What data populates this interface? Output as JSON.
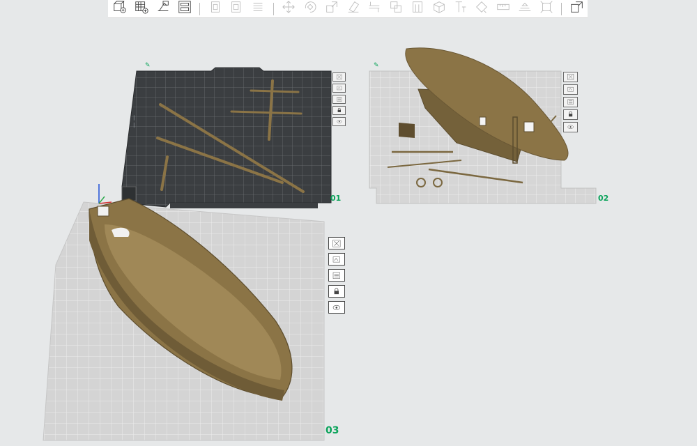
{
  "toolbar": {
    "items": [
      {
        "name": "add-object-icon",
        "enabled": true
      },
      {
        "name": "add-plate-icon",
        "enabled": true
      },
      {
        "name": "auto-orient-icon",
        "enabled": true
      },
      {
        "name": "arrange-icon",
        "enabled": true
      },
      {
        "name": "copy-icon",
        "enabled": false
      },
      {
        "name": "paste-icon",
        "enabled": false
      },
      {
        "name": "layers-icon",
        "enabled": false
      },
      {
        "name": "move-icon",
        "enabled": false
      },
      {
        "name": "rotate-icon",
        "enabled": false
      },
      {
        "name": "scale-icon",
        "enabled": false
      },
      {
        "name": "lay-on-face-icon",
        "enabled": false
      },
      {
        "name": "cut-icon",
        "enabled": false
      },
      {
        "name": "boolean-icon",
        "enabled": false
      },
      {
        "name": "support-paint-icon",
        "enabled": false
      },
      {
        "name": "box-icon",
        "enabled": false
      },
      {
        "name": "text-icon",
        "enabled": false
      },
      {
        "name": "paint-icon",
        "enabled": false
      },
      {
        "name": "measure-icon",
        "enabled": false
      },
      {
        "name": "assembly-icon",
        "enabled": false
      },
      {
        "name": "fit-view-icon",
        "enabled": false
      },
      {
        "name": "split-to-objects-icon",
        "enabled": true
      }
    ]
  },
  "plates": [
    {
      "number": "01",
      "status": "sliced"
    },
    {
      "number": "02",
      "status": "unsliced"
    },
    {
      "number": "03",
      "status": "active"
    }
  ],
  "plate_buttons": [
    "close-icon",
    "auto-arrange-icon",
    "plate-settings-icon",
    "lock-icon",
    "view-icon"
  ],
  "colors": {
    "accent": "#0aa35a",
    "model": "#8b7446",
    "plate_dark": "#3a3d40",
    "plate_light": "#d3d3d3",
    "background": "#e6e8e9"
  }
}
